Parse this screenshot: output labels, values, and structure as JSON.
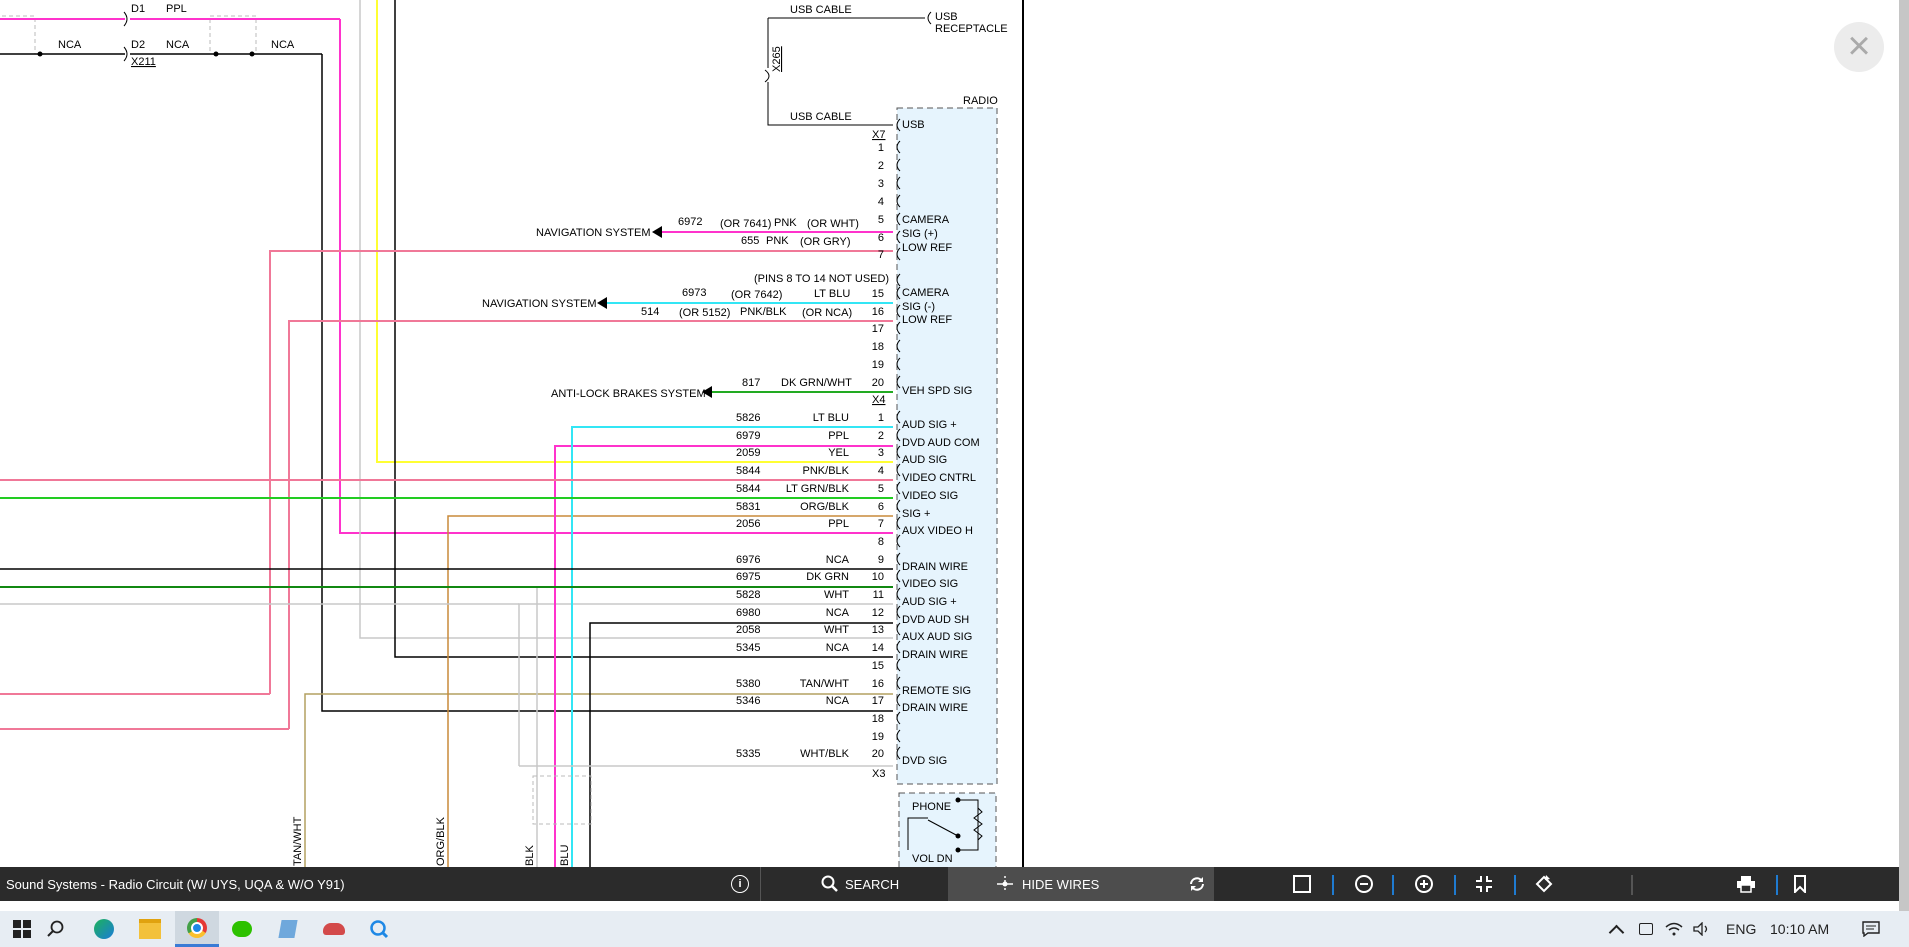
{
  "schematic": {
    "close_label": "×",
    "top_left": {
      "d1": "D1",
      "ppl": "PPL",
      "d2": "D2",
      "nca1": "NCA",
      "nca2": "NCA",
      "nca3": "NCA",
      "x211": "X211"
    },
    "usb": {
      "cable_top": "USB CABLE",
      "receptacle_1": "USB",
      "receptacle_2": "RECEPTACLE",
      "x265": "X265",
      "cable_bottom": "USB CABLE"
    },
    "radio": {
      "title": "RADIO",
      "usb_pin": "USB",
      "x7": "X7",
      "x4": "X4",
      "x3": "X3",
      "pins_not_used": "(PINS 8 TO 14 NOT USED)",
      "x7_pins": [
        "1",
        "2",
        "3",
        "4",
        "5",
        "6",
        "7"
      ],
      "x7_lower_pins": [
        "15",
        "16",
        "17",
        "18",
        "19",
        "20"
      ],
      "camera_plus_1": "CAMERA",
      "camera_plus_2": "SIG (+)",
      "low_ref_1": "LOW REF",
      "camera_minus_1": "CAMERA",
      "camera_minus_2": "SIG (-)",
      "low_ref_2": "LOW REF",
      "veh_spd": "VEH SPD SIG",
      "phone": "PHONE",
      "vol_dn": "VOL DN"
    },
    "signals": {
      "nav1": "NAVIGATION SYSTEM",
      "w6972": "6972",
      "or7641": "(OR 7641)",
      "pnk1": "PNK",
      "orwht": "(OR WHT)",
      "w655": "655",
      "pnk2": "PNK",
      "orgry": "(OR GRY)",
      "nav2": "NAVIGATION SYSTEM",
      "w6973": "6973",
      "or7642": "(OR 7642)",
      "ltblu1": "LT BLU",
      "w514": "514",
      "or5152": "(OR 5152)",
      "pnkblk1": "PNK/BLK",
      "ornca": "(OR NCA)",
      "abs": "ANTI-LOCK BRAKES SYSTEM",
      "w817": "817",
      "dkgrnwht": "DK GRN/WHT"
    },
    "x3_rows": [
      {
        "pin": "1",
        "circuit": "5826",
        "color": "LT BLU",
        "func": "AUD SIG +"
      },
      {
        "pin": "2",
        "circuit": "6979",
        "color": "PPL",
        "func": "DVD AUD COM"
      },
      {
        "pin": "3",
        "circuit": "2059",
        "color": "YEL",
        "func": "AUD SIG"
      },
      {
        "pin": "4",
        "circuit": "5844",
        "color": "PNK/BLK",
        "func": "VIDEO CNTRL"
      },
      {
        "pin": "5",
        "circuit": "5844",
        "color": "LT GRN/BLK",
        "func": "VIDEO SIG"
      },
      {
        "pin": "6",
        "circuit": "5831",
        "color": "ORG/BLK",
        "func": "SIG +"
      },
      {
        "pin": "7",
        "circuit": "2056",
        "color": "PPL",
        "func": "AUX VIDEO H"
      },
      {
        "pin": "8",
        "circuit": "",
        "color": "",
        "func": ""
      },
      {
        "pin": "9",
        "circuit": "6976",
        "color": "NCA",
        "func": "DRAIN WIRE"
      },
      {
        "pin": "10",
        "circuit": "6975",
        "color": "DK GRN",
        "func": "VIDEO SIG"
      },
      {
        "pin": "11",
        "circuit": "5828",
        "color": "WHT",
        "func": "AUD SIG +"
      },
      {
        "pin": "12",
        "circuit": "6980",
        "color": "NCA",
        "func": "DVD AUD SH"
      },
      {
        "pin": "13",
        "circuit": "2058",
        "color": "WHT",
        "func": "AUX AUD SIG"
      },
      {
        "pin": "14",
        "circuit": "5345",
        "color": "NCA",
        "func": "DRAIN WIRE"
      },
      {
        "pin": "15",
        "circuit": "",
        "color": "",
        "func": ""
      },
      {
        "pin": "16",
        "circuit": "5380",
        "color": "TAN/WHT",
        "func": "REMOTE SIG"
      },
      {
        "pin": "17",
        "circuit": "5346",
        "color": "NCA",
        "func": "DRAIN WIRE"
      },
      {
        "pin": "18",
        "circuit": "",
        "color": "",
        "func": ""
      },
      {
        "pin": "19",
        "circuit": "",
        "color": "",
        "func": ""
      },
      {
        "pin": "20",
        "circuit": "5335",
        "color": "WHT/BLK",
        "func": "DVD SIG"
      }
    ],
    "vertical_labels": {
      "tanwht": "TAN/WHT",
      "orgblk": "ORG/BLK",
      "blu": "BLU",
      "blk": "BLK"
    }
  },
  "toolbar": {
    "title": "Sound Systems - Radio Circuit (W/ UYS, UQA & W/O Y91)",
    "info_icon": "i",
    "search_label": "SEARCH",
    "hide_wires_label": "HIDE WIRES"
  },
  "taskbar": {
    "lang": "ENG",
    "time": "10:10 AM"
  },
  "colors": {
    "pink_magenta": "#ff33cc",
    "light_pink": "#f07898",
    "cyan": "#33e6f5",
    "yellow": "#ffff33",
    "green": "#22cc22",
    "dark_green": "#118811",
    "orange": "#c98a3a",
    "tan": "#b3a060",
    "gray": "#bdbdbd",
    "radio_fill": "#e6f4fd",
    "toolbar_bg": "#2b2b2b"
  }
}
